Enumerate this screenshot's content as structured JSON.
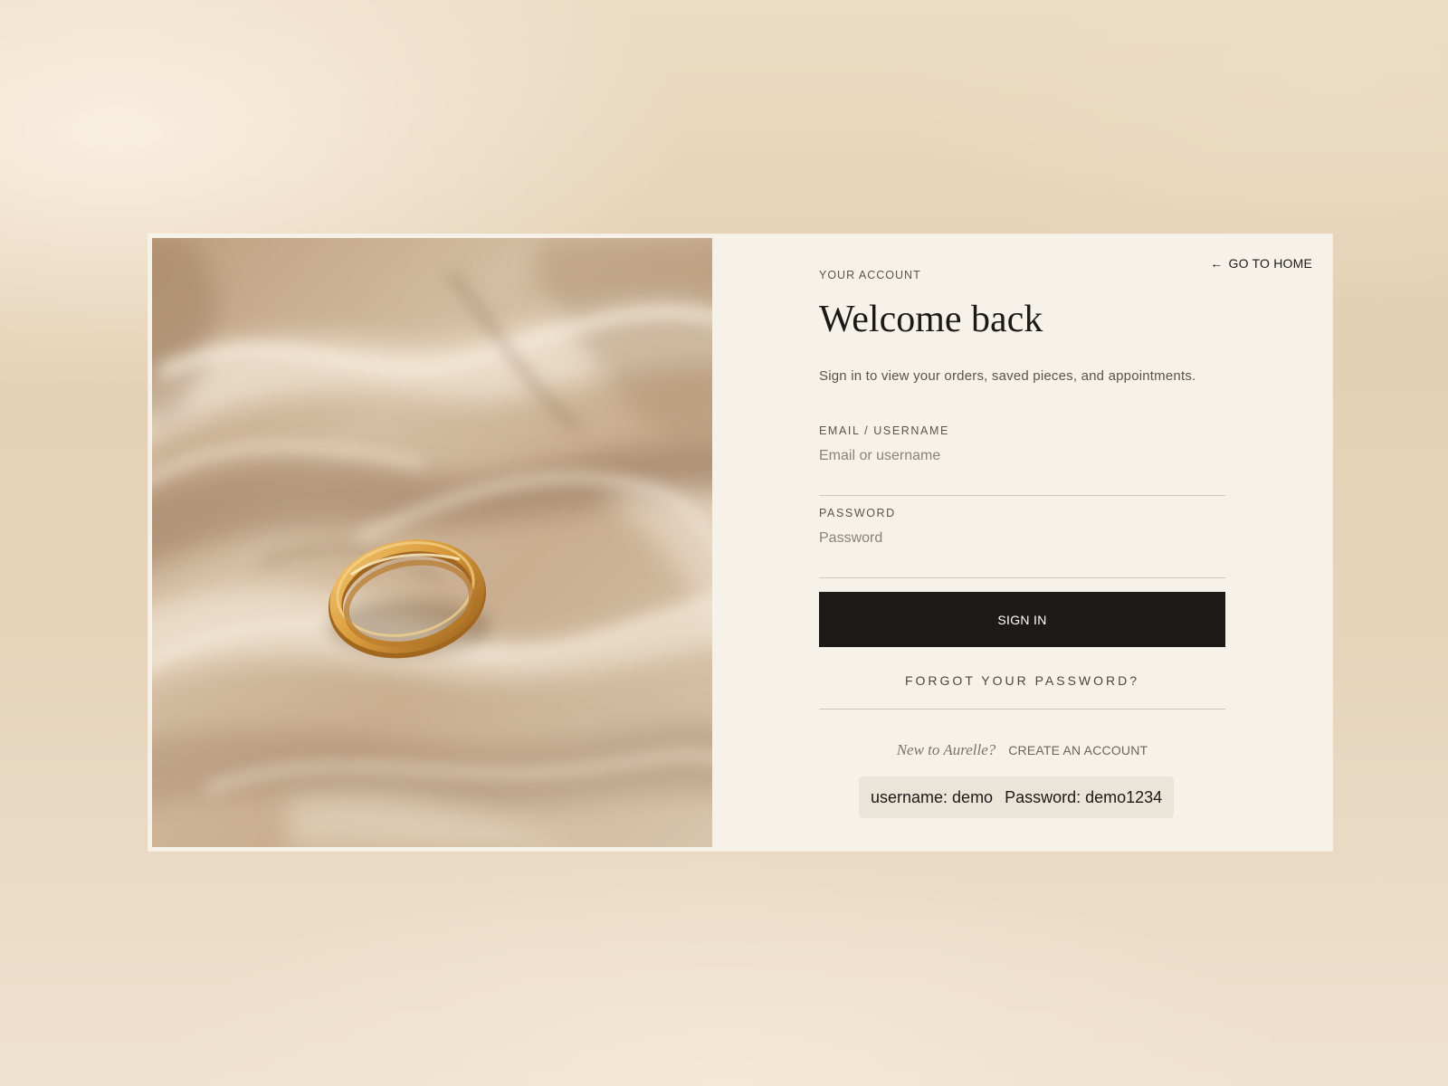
{
  "nav": {
    "back_arrow": "←",
    "go_home_label": "GO TO HOME"
  },
  "header": {
    "eyebrow": "YOUR ACCOUNT",
    "title": "Welcome back",
    "subtitle": "Sign in to view your orders, saved pieces, and appointments."
  },
  "form": {
    "email_label": "EMAIL / USERNAME",
    "email_placeholder": "Email or username",
    "email_value": "",
    "password_label": "PASSWORD",
    "password_placeholder": "Password",
    "password_value": "",
    "submit_label": "SIGN IN",
    "forgot_label": "FORGOT YOUR PASSWORD?"
  },
  "signup": {
    "prompt": "New to Aurelle?",
    "link_label": "CREATE AN ACCOUNT"
  },
  "demo": {
    "username_text": "username: demo",
    "password_text": "Password: demo1234"
  },
  "colors": {
    "accent_dark": "#1c1a17",
    "panel_bg": "#f7f2e9",
    "muted_text": "#5a544b",
    "ring_gold": "#d89a3a"
  },
  "image": {
    "subject": "gold ring on beige satin"
  }
}
